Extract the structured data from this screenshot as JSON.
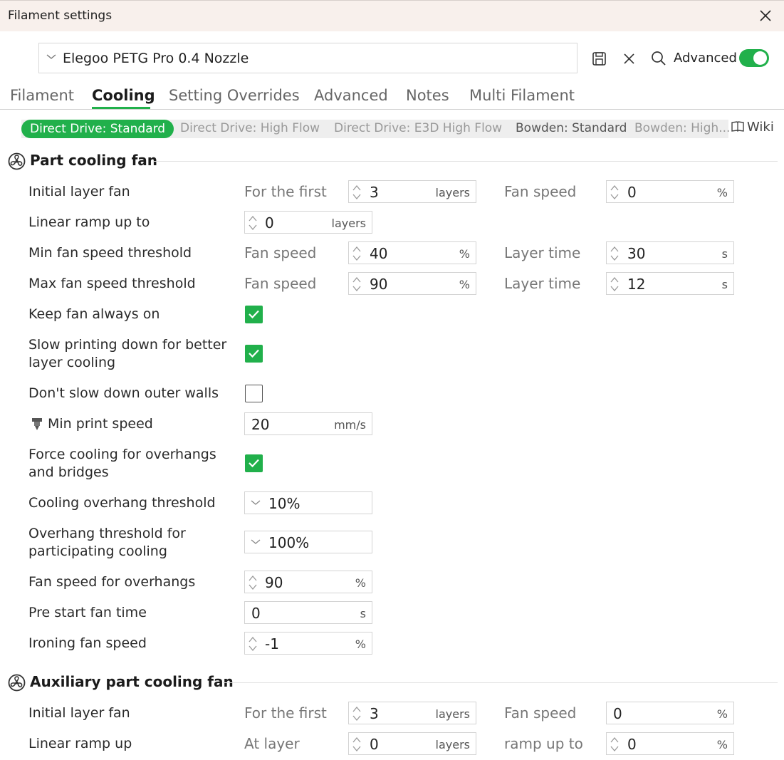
{
  "window": {
    "title": "Filament settings"
  },
  "preset": {
    "name": "Elegoo PETG Pro 0.4 Nozzle"
  },
  "toolbar": {
    "advanced_label": "Advanced",
    "advanced_on": true
  },
  "tabs": [
    {
      "label": "Filament"
    },
    {
      "label": "Cooling"
    },
    {
      "label": "Setting Overrides"
    },
    {
      "label": "Advanced"
    },
    {
      "label": "Notes"
    },
    {
      "label": "Multi Filament"
    }
  ],
  "subtabs": [
    {
      "label": "Direct Drive: Standard"
    },
    {
      "label": "Direct Drive: High Flow"
    },
    {
      "label": "Direct Drive: E3D High Flow"
    },
    {
      "label": "Bowden: Standard"
    },
    {
      "label": "Bowden: High..."
    }
  ],
  "wiki_label": "Wiki",
  "part_fan": {
    "title": "Part cooling fan",
    "initial_layer_fan": {
      "label": "Initial layer fan",
      "sub1": "For the first",
      "value1": "3",
      "unit1": "layers",
      "sub2": "Fan speed",
      "value2": "0",
      "unit2": "%"
    },
    "linear_ramp": {
      "label": "Linear ramp up to",
      "value": "0",
      "unit": "layers"
    },
    "min_threshold": {
      "label": "Min fan speed threshold",
      "sub1": "Fan speed",
      "value1": "40",
      "unit1": "%",
      "sub2": "Layer time",
      "value2": "30",
      "unit2": "s"
    },
    "max_threshold": {
      "label": "Max fan speed threshold",
      "sub1": "Fan speed",
      "value1": "90",
      "unit1": "%",
      "sub2": "Layer time",
      "value2": "12",
      "unit2": "s"
    },
    "keep_fan_on": {
      "label": "Keep fan always on",
      "checked": true
    },
    "slow_down": {
      "label_line1": "Slow printing down for better",
      "label_line2": "layer cooling",
      "checked": true
    },
    "dont_slow_walls": {
      "label": "Don't slow down outer walls",
      "checked": false
    },
    "min_print_speed": {
      "label": "Min print speed",
      "value": "20",
      "unit": "mm/s"
    },
    "force_cooling": {
      "label_line1": "Force cooling for overhangs",
      "label_line2": "and bridges",
      "checked": true
    },
    "overhang_threshold": {
      "label": "Cooling overhang threshold",
      "value": "10%"
    },
    "participating_threshold": {
      "label_line1": "Overhang threshold for",
      "label_line2": "participating cooling",
      "value": "100%"
    },
    "overhang_fan_speed": {
      "label": "Fan speed for overhangs",
      "value": "90",
      "unit": "%"
    },
    "pre_start_fan": {
      "label": "Pre start fan time",
      "value": "0",
      "unit": "s"
    },
    "ironing_fan": {
      "label": "Ironing fan speed",
      "value": "-1",
      "unit": "%"
    }
  },
  "aux_fan": {
    "title": "Auxiliary part cooling fan",
    "initial_layer_fan": {
      "label": "Initial layer fan",
      "sub1": "For the first",
      "value1": "3",
      "unit1": "layers",
      "sub2": "Fan speed",
      "value2": "0",
      "unit2": "%"
    },
    "linear_ramp": {
      "label": "Linear ramp up",
      "sub1": "At layer",
      "value1": "0",
      "unit1": "layers",
      "sub2": "ramp up to",
      "value2": "0",
      "unit2": "%"
    }
  },
  "colors": {
    "accent": "#21b04b",
    "titlebar_bg": "#f8f0ec"
  },
  "icons": [
    "close-icon",
    "chevron-down-icon",
    "save-icon",
    "discard-icon",
    "search-icon",
    "book-icon",
    "fan-icon",
    "spinner-arrows-icon",
    "nozzle-icon",
    "checkmark-icon"
  ]
}
